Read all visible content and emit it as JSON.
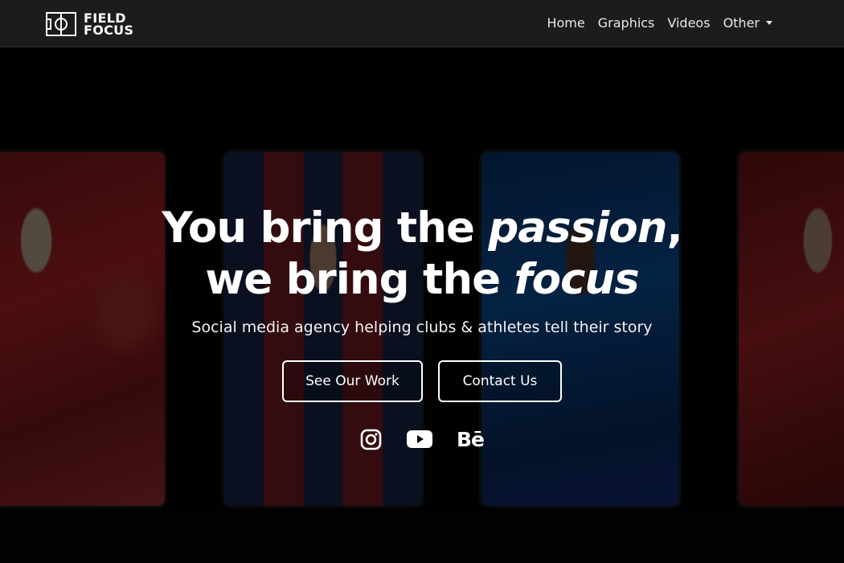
{
  "brand": {
    "line1": "FIELD",
    "line2": "FOCUS",
    "logo_icon": "field-pitch-icon"
  },
  "nav": {
    "items": [
      {
        "label": "Home"
      },
      {
        "label": "Graphics"
      },
      {
        "label": "Videos"
      },
      {
        "label": "Other"
      }
    ]
  },
  "hero": {
    "headline_part1": "You bring the ",
    "headline_em1": "passion",
    "headline_part2": ",",
    "headline_part3": "we bring the ",
    "headline_em2": "focus",
    "subtitle": "Social media agency helping clubs & athletes tell their story",
    "primary_button": "See Our Work",
    "secondary_button": "Contact Us",
    "socials": [
      {
        "icon": "instagram-icon"
      },
      {
        "icon": "youtube-icon"
      },
      {
        "icon": "behance-icon",
        "text": "Bē"
      }
    ]
  },
  "colors": {
    "navbar_bg": "#1c1c1c",
    "page_bg": "#050505",
    "text": "#ffffff"
  }
}
